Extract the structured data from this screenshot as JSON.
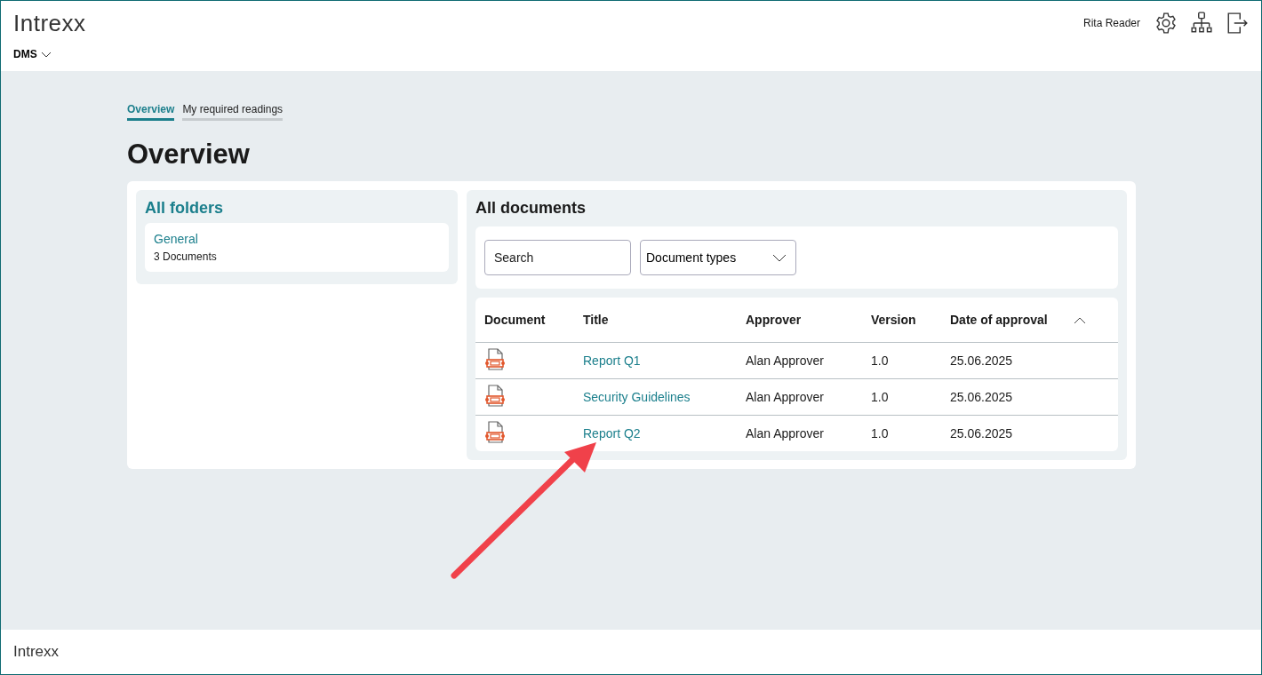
{
  "header": {
    "logo": "Intrexx",
    "app_menu": "DMS",
    "user": "Rita Reader"
  },
  "tabs": [
    {
      "label": "Overview",
      "selected": true
    },
    {
      "label": "My required readings",
      "selected": false
    }
  ],
  "page_title": "Overview",
  "folders": {
    "title": "All folders",
    "items": [
      {
        "name": "General",
        "count": "3",
        "count_label": "Documents"
      }
    ]
  },
  "documents": {
    "title": "All documents",
    "search": {
      "placeholder": "Search"
    },
    "type_filter": "Document types",
    "columns": [
      "Document",
      "Title",
      "Approver",
      "Version",
      "Date of approval"
    ],
    "rows": [
      {
        "title": "Report Q1",
        "approver": "Alan Approver",
        "version": "1.0",
        "date": "25.06.2025"
      },
      {
        "title": "Security Guidelines",
        "approver": "Alan Approver",
        "version": "1.0",
        "date": "25.06.2025"
      },
      {
        "title": "Report Q2",
        "approver": "Alan Approver",
        "version": "1.0",
        "date": "25.06.2025"
      }
    ]
  },
  "footer": {
    "logo": "Intrexx"
  }
}
